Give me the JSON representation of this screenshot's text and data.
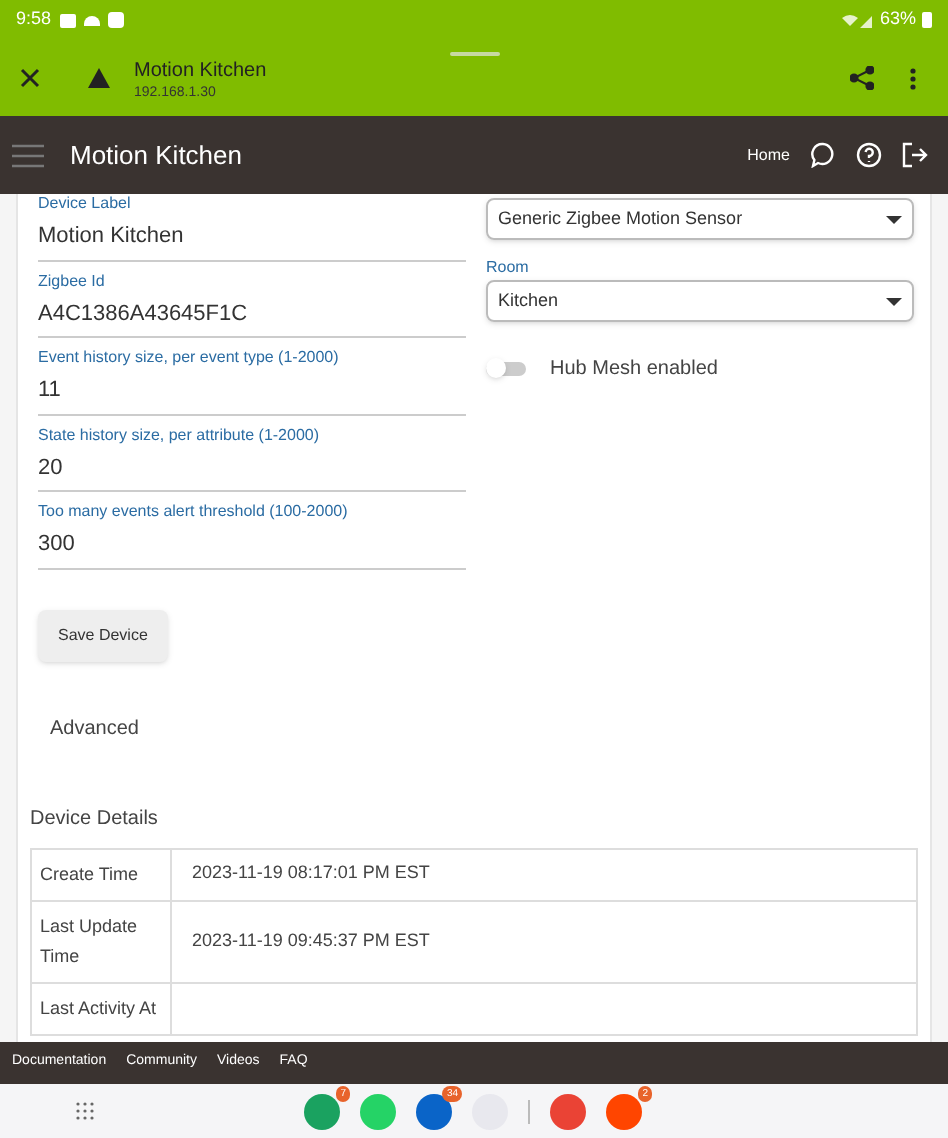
{
  "status_bar": {
    "time": "9:58",
    "battery": "63%"
  },
  "browser": {
    "title": "Motion Kitchen",
    "url": "192.168.1.30"
  },
  "header": {
    "title": "Motion Kitchen",
    "home": "Home"
  },
  "fields": [
    {
      "label": "Device Label",
      "value": "Motion Kitchen"
    },
    {
      "label": "Zigbee Id",
      "value": "A4C1386A43645F1C"
    },
    {
      "label": "Event history size, per event type (1-2000)",
      "value": "11"
    },
    {
      "label": "State history size, per attribute (1-2000)",
      "value": "20"
    },
    {
      "label": "Too many events alert threshold (100-2000)",
      "value": "300"
    }
  ],
  "type_select": {
    "value": "Generic Zigbee Motion Sensor"
  },
  "room_select": {
    "label": "Room",
    "value": "Kitchen"
  },
  "hub_mesh": {
    "label": "Hub Mesh enabled",
    "on": false
  },
  "save_button": "Save Device",
  "advanced": "Advanced",
  "details": {
    "title": "Device Details",
    "rows": [
      {
        "name": "Create Time",
        "value": "2023-11-19 08:17:01 PM EST"
      },
      {
        "name": "Last Update Time",
        "value": "2023-11-19 09:45:37 PM EST"
      },
      {
        "name": "Last Activity At",
        "value": ""
      }
    ]
  },
  "footer_links": [
    "Documentation",
    "Community",
    "Videos",
    "FAQ"
  ],
  "dock": [
    {
      "badge": "7",
      "color": "#1aa260"
    },
    {
      "color": "#25d366"
    },
    {
      "badge": "34",
      "color": "#0a64c8"
    },
    {
      "color": "#e8e8ee"
    },
    {
      "color": "#ea4335"
    },
    {
      "badge": "2",
      "color": "#ff4500"
    }
  ]
}
